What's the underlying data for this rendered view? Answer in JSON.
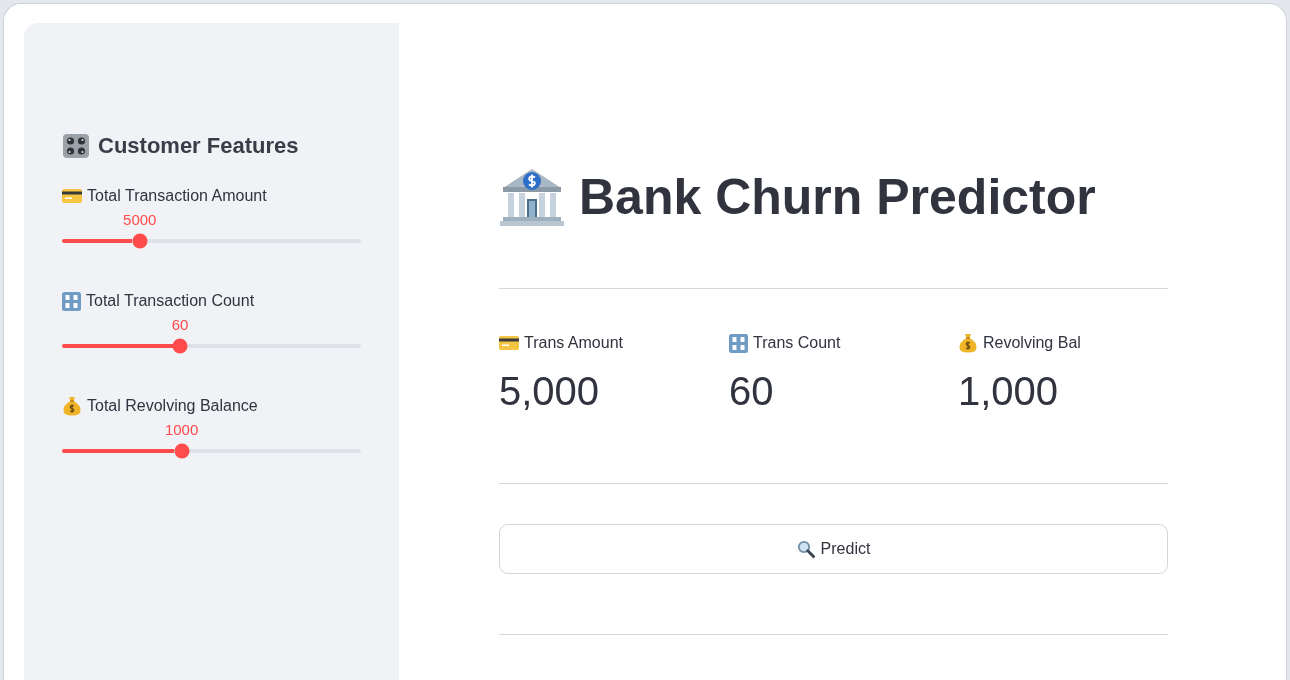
{
  "sidebar": {
    "title": "Customer Features",
    "sliders": [
      {
        "label": "Total Transaction Amount",
        "value": "5000",
        "level": 0.26
      },
      {
        "label": "Total Transaction Count",
        "value": "60",
        "level": 0.395
      },
      {
        "label": "Total Revolving Balance",
        "value": "1000",
        "level": 0.4
      }
    ]
  },
  "header": {
    "title": "Bank Churn Predictor"
  },
  "metrics": [
    {
      "label": "Trans Amount",
      "value": "5,000"
    },
    {
      "label": "Trans Count",
      "value": "60"
    },
    {
      "label": "Revolving Bal",
      "value": "1,000"
    }
  ],
  "predict_button": {
    "label": "Predict"
  }
}
